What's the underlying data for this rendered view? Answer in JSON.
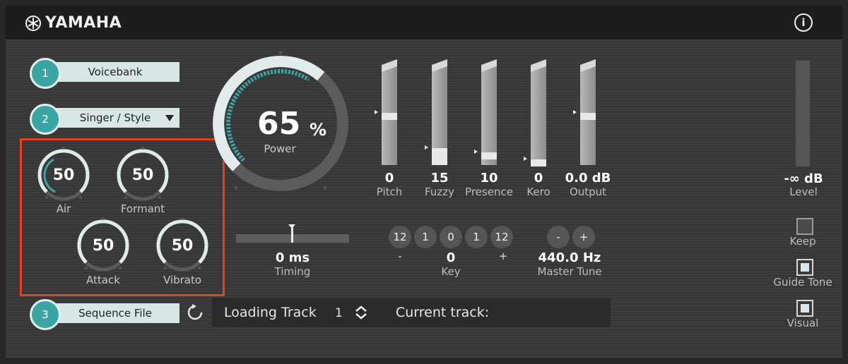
{
  "header": {
    "brand": "YAMAHA",
    "info_glyph": "i"
  },
  "steps": {
    "voicebank": {
      "num": "1",
      "label": "Voicebank"
    },
    "singer": {
      "num": "2",
      "label": "Singer / Style"
    },
    "sequence": {
      "num": "3",
      "label": "Sequence File"
    }
  },
  "knobs": {
    "air": {
      "value": "50",
      "label": "Air"
    },
    "formant": {
      "value": "50",
      "label": "Formant"
    },
    "attack": {
      "value": "50",
      "label": "Attack"
    },
    "vibrato": {
      "value": "50",
      "label": "Vibrato"
    }
  },
  "power": {
    "value": "65",
    "unit": "%",
    "label": "Power",
    "fraction": 0.65
  },
  "faders": [
    {
      "name": "Pitch",
      "value": "0"
    },
    {
      "name": "Fuzzy",
      "value": "15"
    },
    {
      "name": "Presence",
      "value": "10"
    },
    {
      "name": "Kero",
      "value": "0"
    },
    {
      "name": "Output",
      "value": "0.0 dB"
    }
  ],
  "level": {
    "value": "-∞ dB",
    "label": "Level"
  },
  "timing": {
    "value": "0 ms",
    "label": "Timing"
  },
  "key": {
    "buttons": [
      "12",
      "1",
      "0",
      "1",
      "12"
    ],
    "minus": "-",
    "plus": "+",
    "value": "0",
    "label": "Key"
  },
  "tune": {
    "minus": "-",
    "plus": "+",
    "value": "440.0 Hz",
    "label": "Master Tune"
  },
  "options": {
    "keep": {
      "label": "Keep",
      "checked": false
    },
    "guide": {
      "label": "Guide Tone",
      "checked": true
    },
    "visual": {
      "label": "Visual",
      "checked": true
    }
  },
  "track": {
    "loading_label": "Loading Track",
    "loading_value": "1",
    "current_label": "Current track:",
    "current_value": ""
  },
  "colors": {
    "accent": "#3aa5a3",
    "highlight": "#e8401c"
  }
}
